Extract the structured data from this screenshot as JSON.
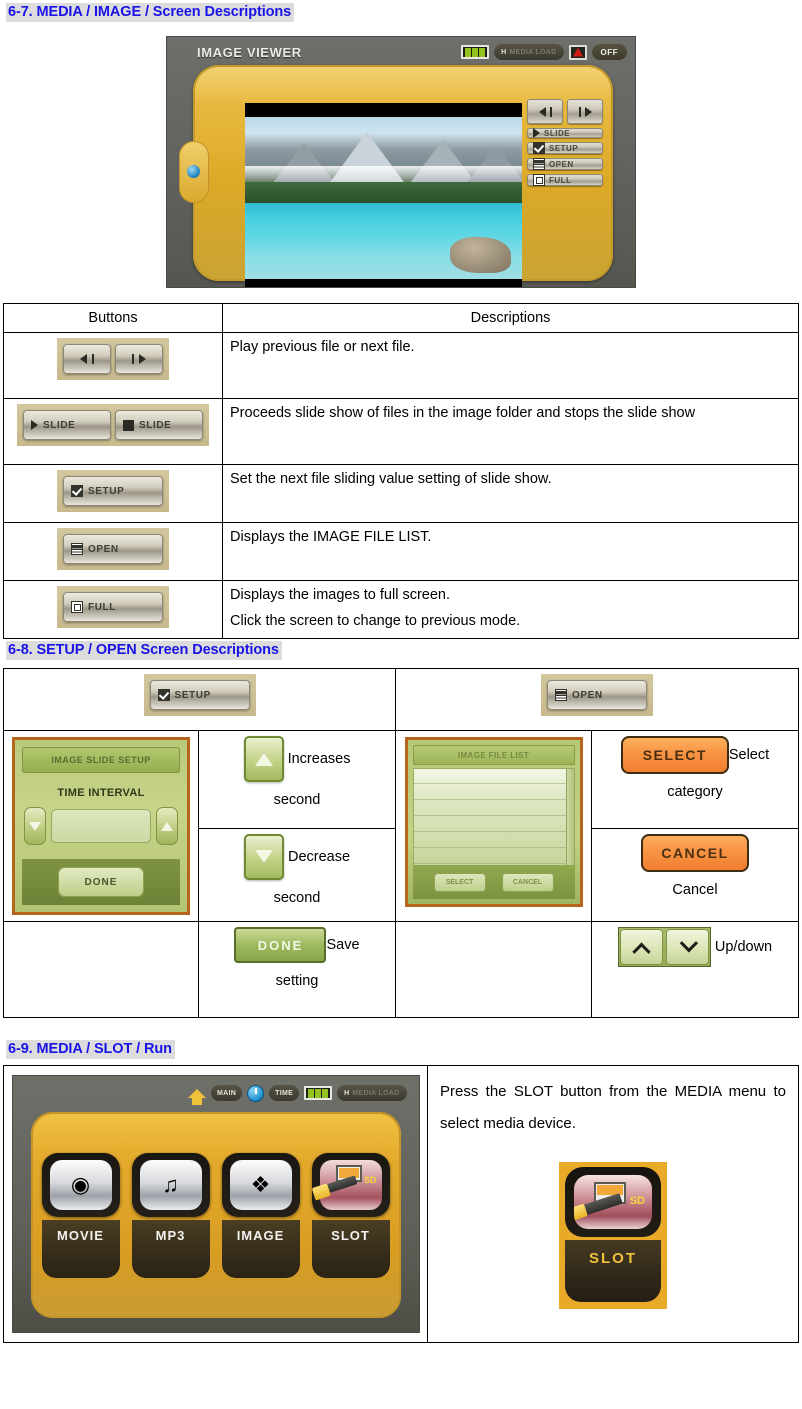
{
  "sections": {
    "s67": {
      "heading": "6-7. MEDIA / IMAGE / Screen Descriptions"
    },
    "s68": {
      "heading": "6-8. SETUP / OPEN Screen Descriptions"
    },
    "s69": {
      "heading": "6-9. MEDIA / SLOT / Run"
    }
  },
  "image_viewer": {
    "title": "IMAGE VIEWER",
    "topbar": {
      "battery_icon": "battery-icon",
      "media_pill_prefix": "H",
      "media_pill_label": "MEDIA LOAD",
      "record_icon": "record-icon",
      "off_label": "OFF"
    },
    "side_buttons": [
      {
        "label": "",
        "icon": "previous-icon"
      },
      {
        "label": "",
        "icon": "next-icon"
      },
      {
        "label": "SLIDE",
        "icon": "play-icon"
      },
      {
        "label": "SETUP",
        "icon": "check-icon"
      },
      {
        "label": "OPEN",
        "icon": "list-icon"
      },
      {
        "label": "FULL",
        "icon": "fullscreen-icon"
      }
    ]
  },
  "button_table": {
    "headers": [
      "Buttons",
      "Descriptions"
    ],
    "rows": [
      {
        "button_kind": "prev-next",
        "buttons": [
          {
            "label": "",
            "icon": "previous-icon"
          },
          {
            "label": "",
            "icon": "next-icon"
          }
        ],
        "lines": [
          "Play previous file or next file."
        ]
      },
      {
        "button_kind": "slide-pair",
        "buttons": [
          {
            "label": "SLIDE",
            "icon": "play-icon"
          },
          {
            "label": "SLIDE",
            "icon": "stop-icon"
          }
        ],
        "lines": [
          "Proceeds slide show of files in the image folder and stops the slide show"
        ]
      },
      {
        "button_kind": "setup",
        "buttons": [
          {
            "label": "SETUP",
            "icon": "check-icon"
          }
        ],
        "lines": [
          "Set the next file sliding value setting of slide show."
        ]
      },
      {
        "button_kind": "open",
        "buttons": [
          {
            "label": "OPEN",
            "icon": "list-icon"
          }
        ],
        "lines": [
          "Displays the IMAGE FILE LIST."
        ]
      },
      {
        "button_kind": "full",
        "buttons": [
          {
            "label": "FULL",
            "icon": "fullscreen-icon"
          }
        ],
        "lines": [
          "Displays the images to full screen.",
          "Click the screen to change to previous mode."
        ]
      }
    ]
  },
  "setup_open_table": {
    "header_setup": {
      "label": "SETUP",
      "icon": "check-icon"
    },
    "header_open": {
      "label": "OPEN",
      "icon": "list-icon"
    },
    "setup_screen": {
      "title": "IMAGE SLIDE SETUP",
      "field_label": "TIME INTERVAL",
      "value": "",
      "down_icon": "arrow-down-icon",
      "up_icon": "arrow-up-icon",
      "done_label": "DONE"
    },
    "setup_controls": [
      {
        "icon": "arrow-up-icon",
        "caption_line1": "Increases",
        "caption_line2": "second"
      },
      {
        "icon": "arrow-down-icon",
        "caption_line1": "Decrease",
        "caption_line2": "second"
      },
      {
        "label": "DONE",
        "caption_line1": "Save",
        "caption_line2": "setting"
      }
    ],
    "open_screen": {
      "title": "IMAGE FILE LIST",
      "footer_buttons": [
        "SELECT",
        "CANCEL"
      ]
    },
    "open_controls": [
      {
        "label": "SELECT",
        "caption_line1": "Select",
        "caption_line2": "category"
      },
      {
        "label": "CANCEL",
        "caption_line1": "Cancel",
        "caption_line2": ""
      },
      {
        "icon": "chevron-up-down-icon",
        "caption_line1": "Up/down",
        "caption_line2": ""
      }
    ]
  },
  "media_slot": {
    "topbar": {
      "home_icon": "home-icon",
      "main_label": "MAIN",
      "clock_icon": "clock-icon",
      "time_label": "TIME",
      "battery_icon": "battery-icon",
      "media_pill_prefix": "H",
      "media_pill_label": "MEDIA LOAD"
    },
    "menu_items": [
      {
        "label": "MOVIE",
        "icon": "film-reel-icon",
        "glyph": "⊙",
        "active": false
      },
      {
        "label": "MP3",
        "icon": "music-notes-icon",
        "glyph": "♫",
        "active": false
      },
      {
        "label": "IMAGE",
        "icon": "photos-icon",
        "glyph": "❖",
        "active": false
      },
      {
        "label": "SLOT",
        "icon": "sd-card-icon",
        "glyph": "",
        "active": true
      }
    ],
    "description": "Press the SLOT button from the MEDIA menu to select media device.",
    "slot_tile": {
      "label": "SLOT",
      "sd_label": "SD",
      "icon": "sd-card-usb-icon"
    }
  },
  "colors": {
    "heading_text": "#1a13e8",
    "heading_bg": "#dcdcdc",
    "bezel_gold": "#e4a92b",
    "accent_orange": "#f07c2e",
    "screen_green": "#b9c97c"
  }
}
